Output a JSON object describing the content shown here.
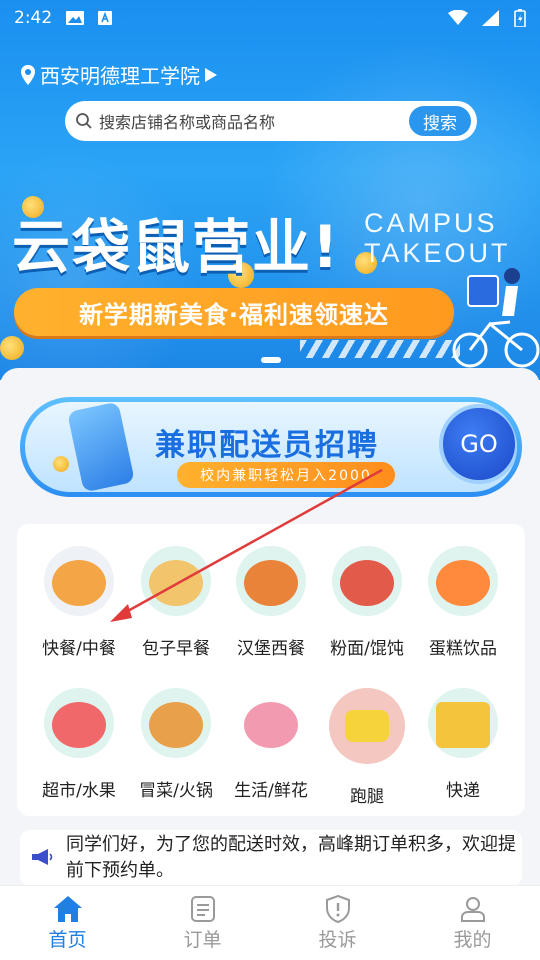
{
  "status_bar": {
    "time": "2:42"
  },
  "location": {
    "name": "西安明德理工学院"
  },
  "search": {
    "placeholder": "搜索店铺名称或商品名称",
    "button": "搜索"
  },
  "banner": {
    "brand": "云袋鼠营业!",
    "english_line1": "CAMPUS",
    "english_line2": "TAKEOUT",
    "slogan": "新学期新美食·福利速领速达"
  },
  "recruit": {
    "title": "兼职配送员招聘",
    "subtitle": "校内兼职轻松月入2000",
    "button": "GO"
  },
  "categories": [
    {
      "label": "快餐/中餐",
      "icon": "fast-food-icon",
      "color": "#f4a545"
    },
    {
      "label": "包子早餐",
      "icon": "breakfast-icon",
      "color": "#f2c46b"
    },
    {
      "label": "汉堡西餐",
      "icon": "burger-icon",
      "color": "#e9833a"
    },
    {
      "label": "粉面/馄饨",
      "icon": "noodles-icon",
      "color": "#e25a4a"
    },
    {
      "label": "蛋糕饮品",
      "icon": "drink-icon",
      "color": "#ff8a3c"
    },
    {
      "label": "超市/水果",
      "icon": "basket-icon",
      "color": "#f0686a"
    },
    {
      "label": "冒菜/火锅",
      "icon": "hotpot-icon",
      "color": "#e9a04a"
    },
    {
      "label": "生活/鲜花",
      "icon": "flowers-icon",
      "color": "#f29bb0"
    },
    {
      "label": "跑腿",
      "icon": "scooter-icon",
      "color": "#f4b8b0"
    },
    {
      "label": "快递",
      "icon": "parcel-cart-icon",
      "color": "#f3c43c"
    }
  ],
  "notice": {
    "text": "同学们好，为了您的配送时效，高峰期订单积多，欢迎提前下预约单。"
  },
  "tabbar": [
    {
      "label": "首页",
      "icon": "home-icon",
      "active": true
    },
    {
      "label": "订单",
      "icon": "order-icon",
      "active": false
    },
    {
      "label": "投诉",
      "icon": "complaint-shield-icon",
      "active": false
    },
    {
      "label": "我的",
      "icon": "profile-icon",
      "active": false
    }
  ],
  "colors": {
    "primary": "#1f7fe3",
    "accent_orange": "#ffa526",
    "annotation_red": "#e03a3a"
  }
}
